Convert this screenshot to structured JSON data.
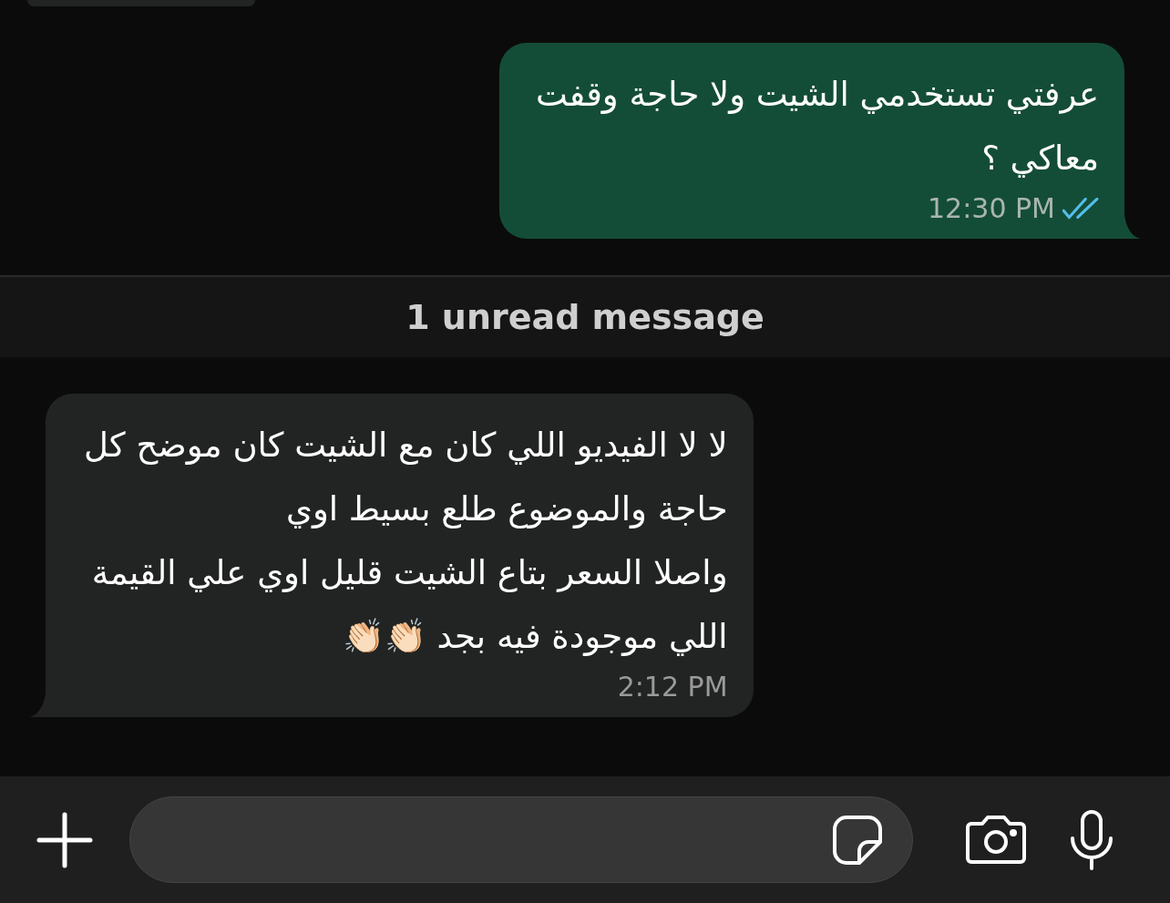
{
  "messages": [
    {
      "kind": "sent",
      "text": "عرفتي تستخدمي الشيت ولا حاجة وقفت\nمعاكي ؟",
      "time": "12:30 PM",
      "read": true
    },
    {
      "kind": "divider",
      "text": "1 unread message"
    },
    {
      "kind": "received",
      "text": "لا لا الفيديو اللي كان مع الشيت كان موضح كل\nحاجة والموضوع طلع بسيط اوي\nواصلا السعر بتاع الشيت قليل اوي علي القيمة\nاللي موجودة فيه بجد 👏🏻👏🏻",
      "time": "2:12 PM"
    }
  ]
}
